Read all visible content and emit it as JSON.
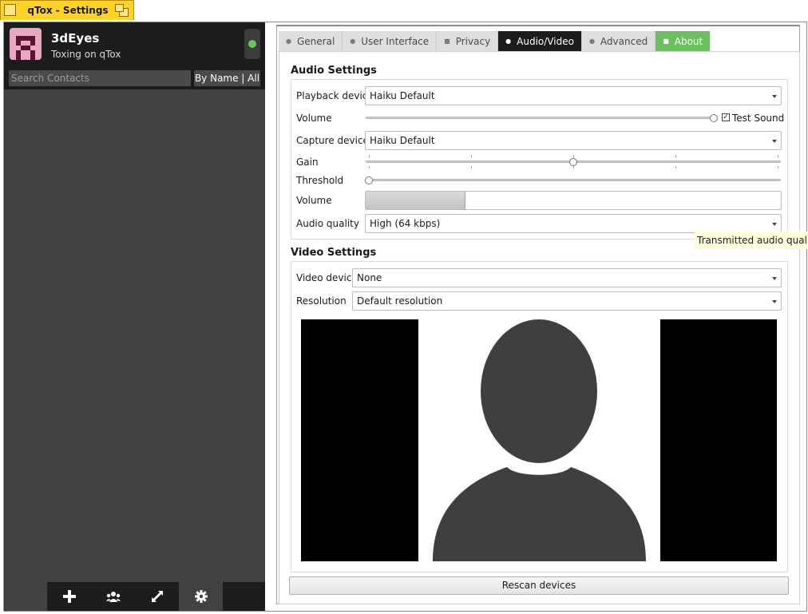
{
  "window": {
    "title": "qTox - Settings"
  },
  "profile": {
    "name": "3dEyes",
    "status_message": "Toxing on qTox",
    "status_color": "#6bc25f"
  },
  "contacts": {
    "search_placeholder": "Search Contacts",
    "filter_label": "By Name | All"
  },
  "bottom_bar": {
    "add_icon": "plus-icon",
    "groups_icon": "group-icon",
    "transfers_icon": "transfer-icon",
    "settings_icon": "gear-icon"
  },
  "tabs": [
    {
      "label": "General"
    },
    {
      "label": "User Interface"
    },
    {
      "label": "Privacy"
    },
    {
      "label": "Audio/Video"
    },
    {
      "label": "Advanced"
    },
    {
      "label": "About"
    }
  ],
  "audio": {
    "title": "Audio Settings",
    "playback_label": "Playback device",
    "playback_value": "Haiku Default",
    "volume_label": "Volume",
    "test_sound_label": "Test Sound",
    "test_sound_checked": true,
    "playback_volume_level": 1.0,
    "capture_label": "Capture device",
    "capture_value": "Haiku Default",
    "gain_label": "Gain",
    "gain_level": 0.5,
    "threshold_label": "Threshold",
    "threshold_level": 0.0,
    "mic_volume_label": "Volume",
    "mic_volume_level": 0.24,
    "quality_label": "Audio quality",
    "quality_value": "High (64 kbps)",
    "quality_tooltip": "Transmitted audio quality."
  },
  "video": {
    "title": "Video Settings",
    "device_label": "Video device",
    "device_value": "None",
    "resolution_label": "Resolution",
    "resolution_value": "Default resolution",
    "rescan_label": "Rescan devices"
  }
}
